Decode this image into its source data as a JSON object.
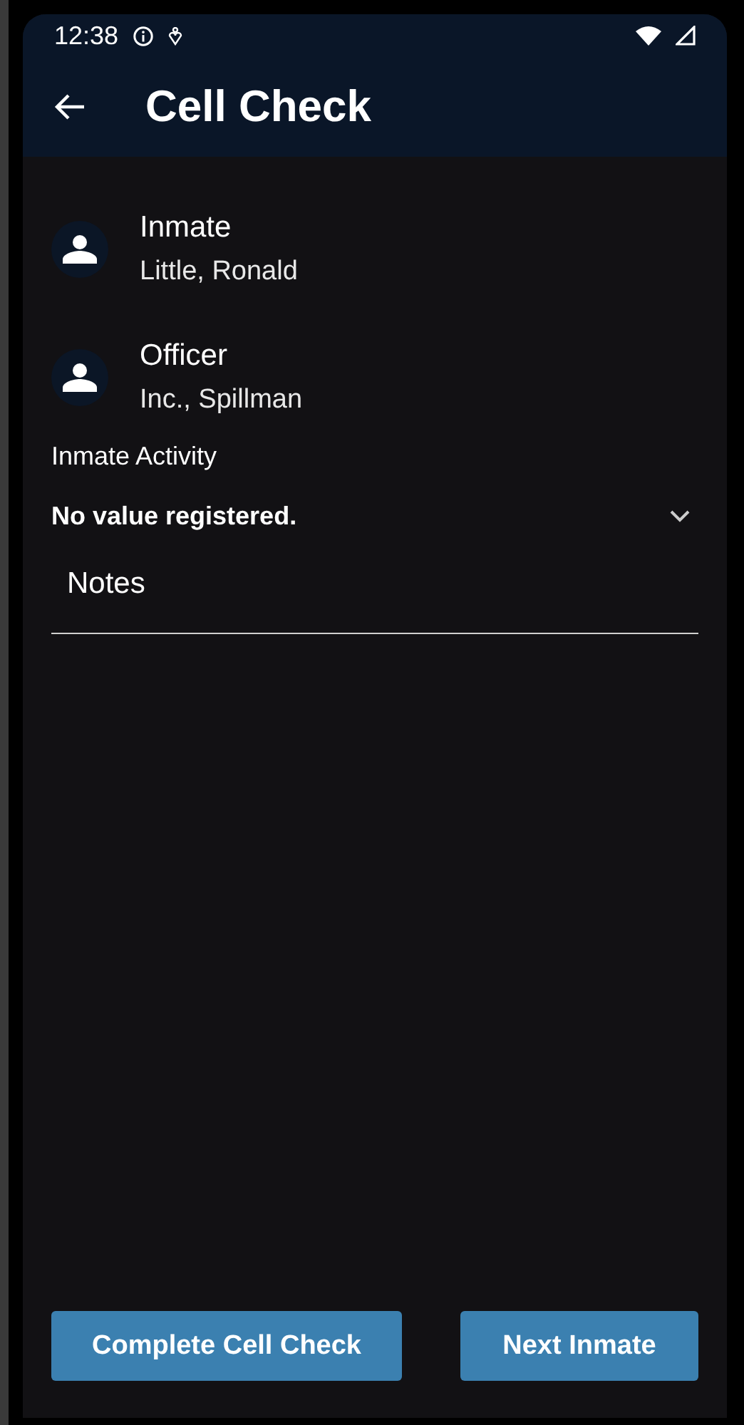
{
  "status_bar": {
    "time": "12:38"
  },
  "header": {
    "title": "Cell Check"
  },
  "people": [
    {
      "label": "Inmate",
      "name": "Little, Ronald"
    },
    {
      "label": "Officer",
      "name": "Inc., Spillman"
    }
  ],
  "activity": {
    "label": "Inmate Activity",
    "value": "No value registered."
  },
  "notes": {
    "placeholder": "Notes"
  },
  "buttons": [
    "Complete Cell Check",
    "Next Inmate"
  ]
}
